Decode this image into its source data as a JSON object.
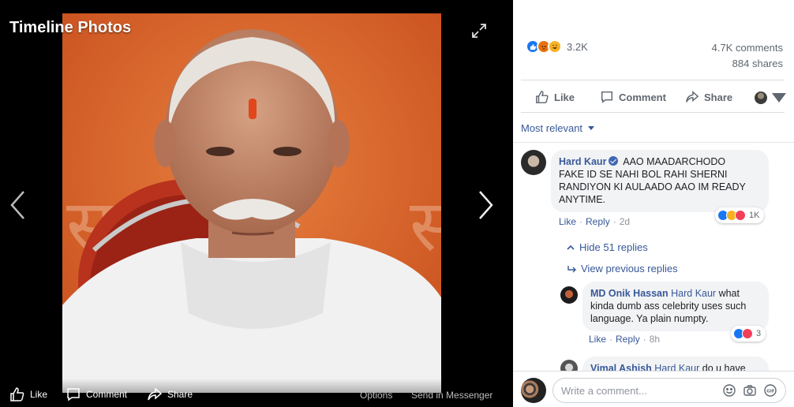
{
  "viewer": {
    "title": "Timeline Photos",
    "bottom_bar": {
      "like": "Like",
      "comment": "Comment",
      "share": "Share",
      "options": "Options",
      "send_in_messenger": "Send in Messenger"
    },
    "photo_text": "स"
  },
  "post": {
    "reaction_icons": [
      "like-icon",
      "angry-icon",
      "haha-icon"
    ],
    "reaction_count": "3.2K",
    "comments": "4.7K comments",
    "shares": "884 shares",
    "actions": {
      "like": "Like",
      "comment": "Comment",
      "share": "Share"
    },
    "sort_label": "Most relevant"
  },
  "comments": [
    {
      "author": "Hard Kaur",
      "verified": true,
      "lines": [
        "AAO MAADARCHODO",
        "FAKE ID SE NAHI BOL RAHI SHERNI",
        "RANDIYON KI AULAADO AAO IM READY",
        "ANYTIME."
      ],
      "like": "Like",
      "reply": "Reply",
      "time": "2d",
      "reactions": "1K",
      "hide_replies": "Hide 51 replies",
      "view_previous": "View previous replies"
    },
    {
      "author": "MD Onik Hassan",
      "mention": "Hard Kaur",
      "lines": [
        " what",
        "kinda dumb ass celebrity uses such",
        "language. Ya plain numpty."
      ],
      "like": "Like",
      "reply": "Reply",
      "time": "8h",
      "reactions": "3"
    },
    {
      "author": "Vimal Ashish",
      "mention": "Hard Kaur",
      "text": " do u have"
    }
  ],
  "composer": {
    "placeholder": "Write a comment..."
  },
  "colors": {
    "link": "#385898",
    "like_blue": "#1877f2",
    "bubble_bg": "#f2f3f5"
  }
}
